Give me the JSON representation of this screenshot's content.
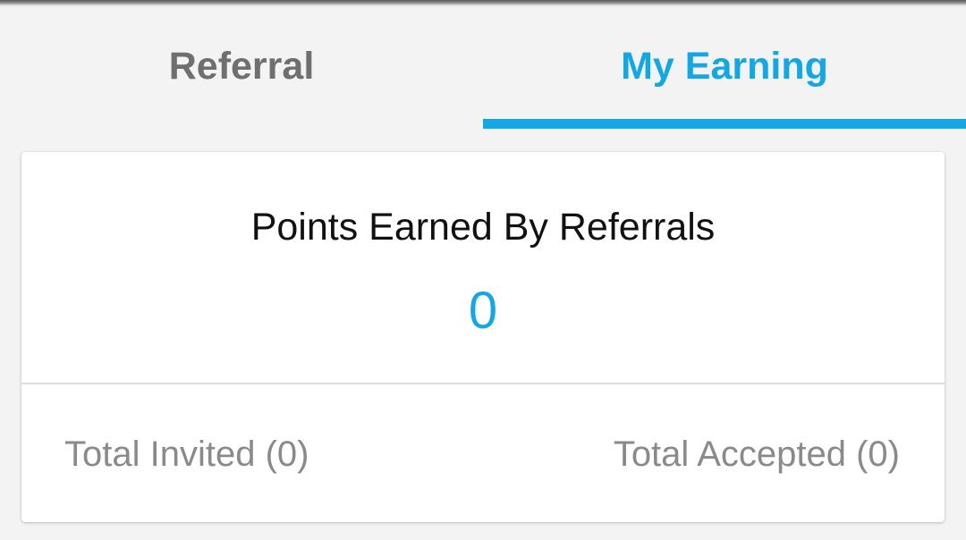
{
  "tabs": [
    {
      "label": "Referral",
      "active": false
    },
    {
      "label": "My Earning",
      "active": true
    }
  ],
  "card": {
    "points_title": "Points Earned By Referrals",
    "points_value": "0",
    "total_invited": "Total Invited (0)",
    "total_accepted": "Total Accepted (0)"
  },
  "colors": {
    "accent": "#13a7e3",
    "inactive_tab": "#6f6f6f",
    "background": "#f3f3f3",
    "card": "#ffffff",
    "muted_text": "#8a8a8a"
  }
}
